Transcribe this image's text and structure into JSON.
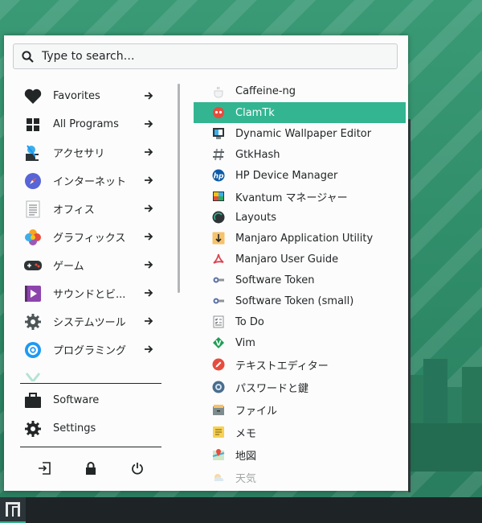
{
  "colors": {
    "accent": "#33b592",
    "panel": "#fcfcfc",
    "taskbar": "#1e2325"
  },
  "search": {
    "placeholder": "Type to search…"
  },
  "categories": [
    {
      "label": "Favorites",
      "icon": "heart-icon"
    },
    {
      "label": "All Programs",
      "icon": "grid-icon"
    },
    {
      "label": "アクセサリ",
      "icon": "accessories-icon"
    },
    {
      "label": "インターネット",
      "icon": "compass-icon"
    },
    {
      "label": "オフィス",
      "icon": "document-icon"
    },
    {
      "label": "グラフィックス",
      "icon": "color-flower-icon"
    },
    {
      "label": "ゲーム",
      "icon": "gamepad-icon"
    },
    {
      "label": "サウンドとビ...",
      "icon": "multimedia-icon"
    },
    {
      "label": "システムツール",
      "icon": "gear-icon"
    },
    {
      "label": "プログラミング",
      "icon": "dev-gear-icon"
    }
  ],
  "system": [
    {
      "label": "Software",
      "icon": "briefcase-icon"
    },
    {
      "label": "Settings",
      "icon": "settings-gear-icon"
    }
  ],
  "session_buttons": [
    "logout-icon",
    "lock-icon",
    "power-icon"
  ],
  "apps": [
    {
      "label": "Caffeine-ng",
      "icon": "coffee-cup-icon"
    },
    {
      "label": "ClamTk",
      "icon": "clamtk-icon"
    },
    {
      "label": "Dynamic Wallpaper Editor",
      "icon": "wallpaper-editor-icon"
    },
    {
      "label": "GtkHash",
      "icon": "hash-icon"
    },
    {
      "label": "HP Device Manager",
      "icon": "hp-icon"
    },
    {
      "label": "Kvantum マネージャー",
      "icon": "kvantum-icon"
    },
    {
      "label": "Layouts",
      "icon": "layouts-icon"
    },
    {
      "label": "Manjaro Application Utility",
      "icon": "download-arrow-icon"
    },
    {
      "label": "Manjaro User Guide",
      "icon": "pdf-icon"
    },
    {
      "label": "Software Token",
      "icon": "token-icon"
    },
    {
      "label": "Software Token (small)",
      "icon": "token-small-icon"
    },
    {
      "label": "To Do",
      "icon": "checklist-icon"
    },
    {
      "label": "Vim",
      "icon": "vim-icon"
    },
    {
      "label": "テキストエディター",
      "icon": "pencil-icon"
    },
    {
      "label": "パスワードと鍵",
      "icon": "keyring-icon"
    },
    {
      "label": "ファイル",
      "icon": "file-cabinet-icon"
    },
    {
      "label": "メモ",
      "icon": "note-icon"
    },
    {
      "label": "地図",
      "icon": "map-icon"
    },
    {
      "label": "天気",
      "icon": "weather-icon"
    }
  ]
}
